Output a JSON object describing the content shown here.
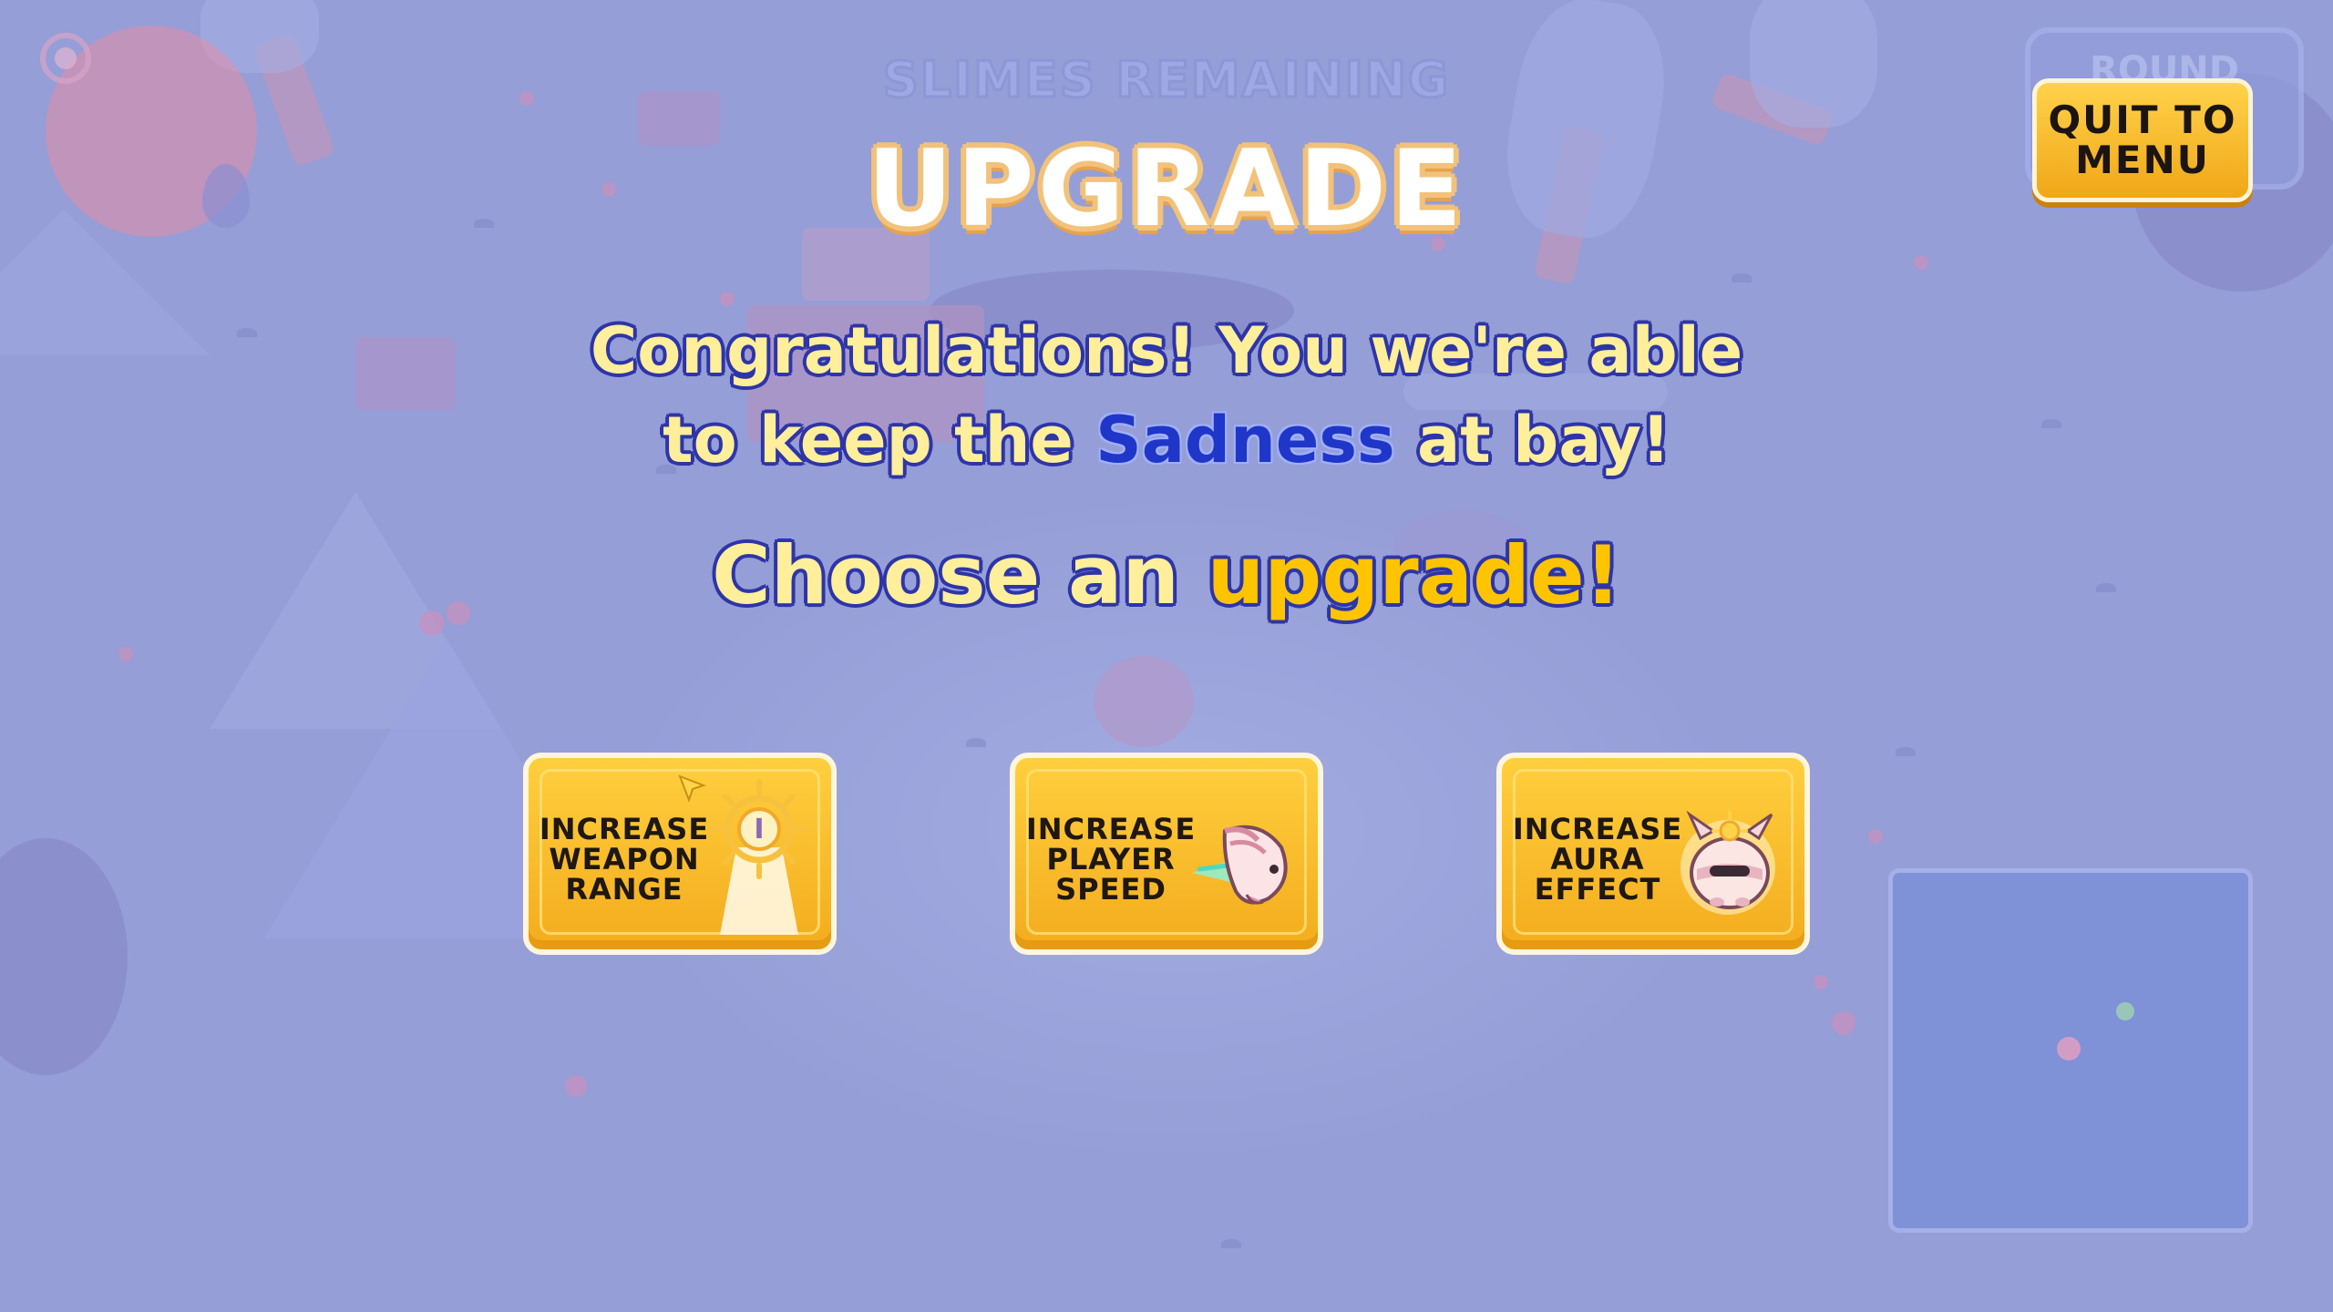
{
  "hud": {
    "slimes_remaining_label": "SLIMES REMAINING",
    "round_label": "ROUND"
  },
  "menu": {
    "quit_label": "QUIT TO\nMENU"
  },
  "upgrade_screen": {
    "title": "UPGRADE",
    "congrats_line1": "Congratulations! You we're able",
    "congrats_line2_before": "to keep the ",
    "congrats_highlight": "Sadness",
    "congrats_line2_after": " at bay!",
    "choose_prefix": "Choose an ",
    "choose_accent": "upgrade!"
  },
  "upgrades": [
    {
      "label": "INCREASE\nWEAPON\nRANGE",
      "icon": "weapon-range-icon"
    },
    {
      "label": "INCREASE\nPLAYER\nSPEED",
      "icon": "player-speed-icon"
    },
    {
      "label": "INCREASE\nAURA\nEFFECT",
      "icon": "aura-effect-icon"
    }
  ],
  "colors": {
    "button_gold": "#ffcf3e",
    "title_outline": "#f2c27a",
    "text_yellow": "#ffee9a",
    "text_outline_blue": "#2d35a8",
    "sadness_blue": "#1f36c9",
    "accent_yellow": "#ffc400"
  }
}
